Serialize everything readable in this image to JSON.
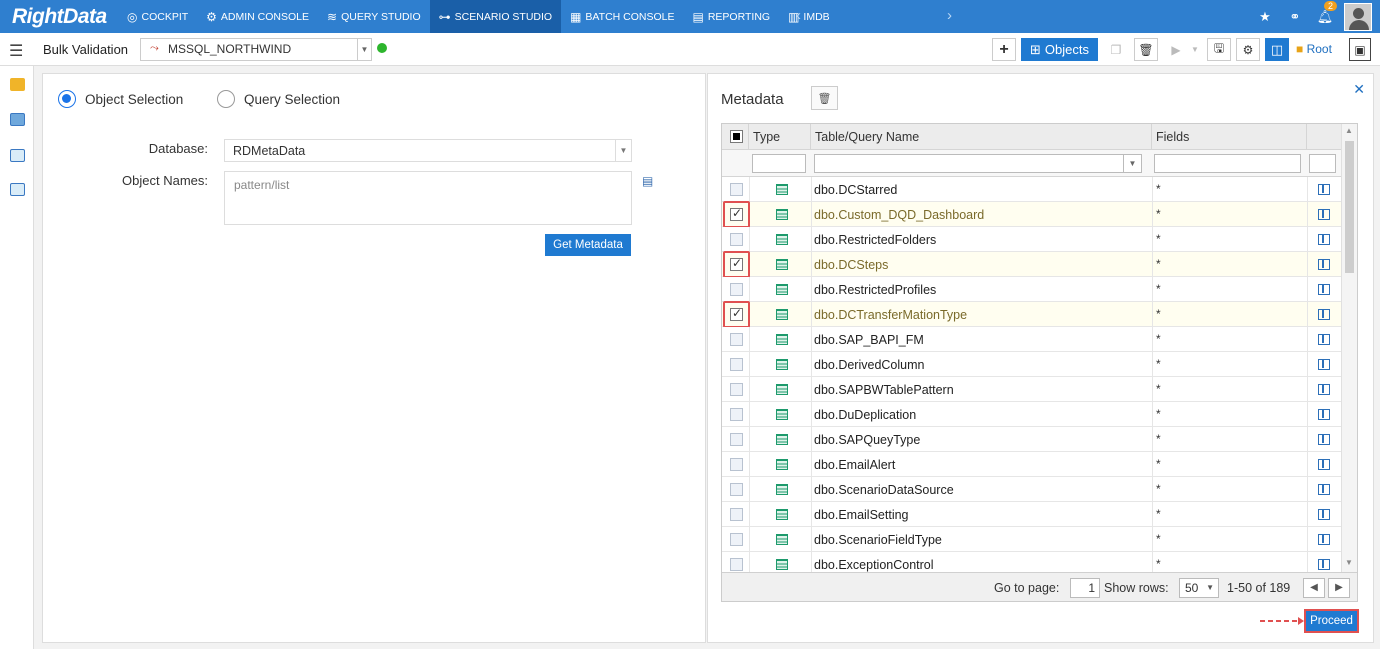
{
  "app": {
    "logo": "RightData"
  },
  "nav": [
    {
      "label": "COCKPIT",
      "icon": "cockpit-icon",
      "glyph": "◎"
    },
    {
      "label": "ADMIN CONSOLE",
      "icon": "gear-icon",
      "glyph": "⚙"
    },
    {
      "label": "QUERY STUDIO",
      "icon": "database-icon",
      "glyph": "≋"
    },
    {
      "label": "SCENARIO STUDIO",
      "icon": "scenario-icon",
      "glyph": "⊶",
      "active": true
    },
    {
      "label": "BATCH CONSOLE",
      "icon": "batch-icon",
      "glyph": "▦"
    },
    {
      "label": "REPORTING",
      "icon": "report-icon",
      "glyph": "▤"
    },
    {
      "label": "IMDB",
      "icon": "imdb-icon",
      "glyph": "▥"
    }
  ],
  "notifications": {
    "count": "2"
  },
  "toolbar": {
    "title": "Bulk Validation",
    "connection": "MSSQL_NORTHWIND",
    "objects_label": "Objects",
    "root_label": "Root"
  },
  "left": {
    "radio_object": "Object Selection",
    "radio_query": "Query Selection",
    "database_label": "Database:",
    "database_value": "RDMetaData",
    "objects_label": "Object Names:",
    "objects_placeholder": "pattern/list",
    "get_metadata": "Get Metadata"
  },
  "metadata": {
    "title": "Metadata",
    "columns": {
      "type": "Type",
      "name": "Table/Query Name",
      "fields": "Fields"
    },
    "rows": [
      {
        "name": "dbo.DCStarred",
        "fields": "*",
        "checked": false
      },
      {
        "name": "dbo.Custom_DQD_Dashboard",
        "fields": "*",
        "checked": true
      },
      {
        "name": "dbo.RestrictedFolders",
        "fields": "*",
        "checked": false
      },
      {
        "name": "dbo.DCSteps",
        "fields": "*",
        "checked": true
      },
      {
        "name": "dbo.RestrictedProfiles",
        "fields": "*",
        "checked": false
      },
      {
        "name": "dbo.DCTransferMationType",
        "fields": "*",
        "checked": true
      },
      {
        "name": "dbo.SAP_BAPI_FM",
        "fields": "*",
        "checked": false
      },
      {
        "name": "dbo.DerivedColumn",
        "fields": "*",
        "checked": false
      },
      {
        "name": "dbo.SAPBWTablePattern",
        "fields": "*",
        "checked": false
      },
      {
        "name": "dbo.DuDeplication",
        "fields": "*",
        "checked": false
      },
      {
        "name": "dbo.SAPQueyType",
        "fields": "*",
        "checked": false
      },
      {
        "name": "dbo.EmailAlert",
        "fields": "*",
        "checked": false
      },
      {
        "name": "dbo.ScenarioDataSource",
        "fields": "*",
        "checked": false
      },
      {
        "name": "dbo.EmailSetting",
        "fields": "*",
        "checked": false
      },
      {
        "name": "dbo.ScenarioFieldType",
        "fields": "*",
        "checked": false
      },
      {
        "name": "dbo.ExceptionControl",
        "fields": "*",
        "checked": false
      }
    ],
    "pager": {
      "goto_label": "Go to page:",
      "page": "1",
      "show_rows_label": "Show rows:",
      "rows_value": "50",
      "range": "1-50 of 189"
    }
  },
  "proceed_label": "Proceed"
}
